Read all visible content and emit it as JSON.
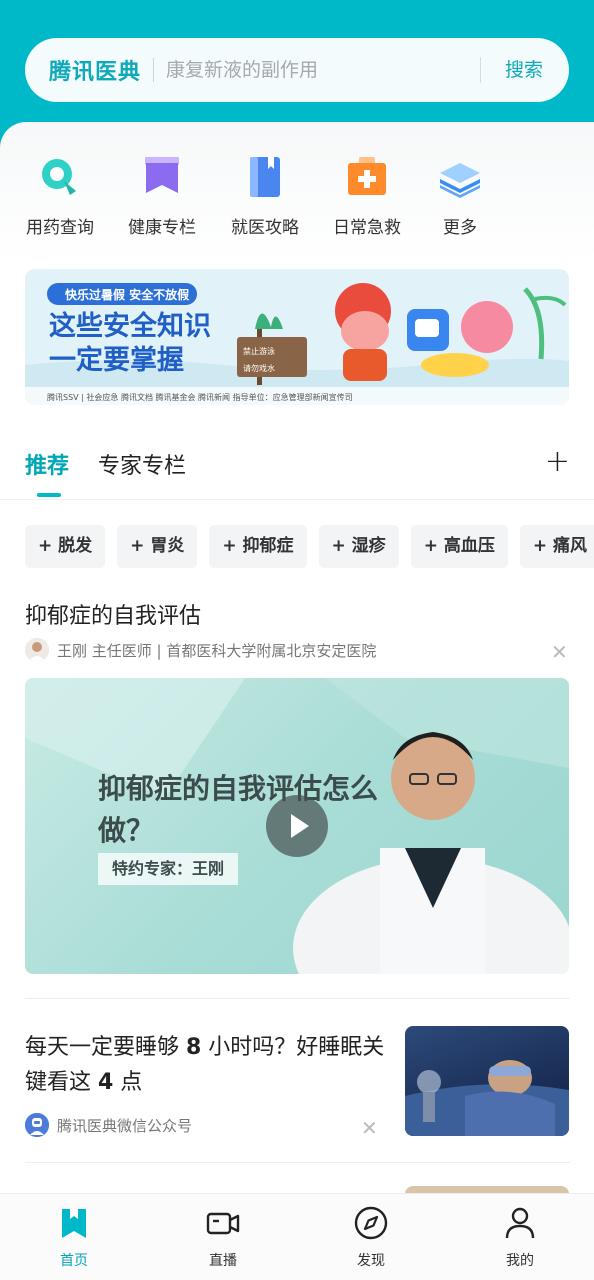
{
  "header": {
    "brand": "腾讯医典",
    "search_placeholder": "康复新液的副作用",
    "search_button": "搜索"
  },
  "quick_entries": [
    {
      "label": "用药查询",
      "icon": "pill-search-icon"
    },
    {
      "label": "健康专栏",
      "icon": "bookmark-icon"
    },
    {
      "label": "就医攻略",
      "icon": "book-icon"
    },
    {
      "label": "日常急救",
      "icon": "first-aid-kit-icon"
    },
    {
      "label": "更多",
      "icon": "layers-icon"
    }
  ],
  "banner": {
    "tagline": "快乐过暑假 安全不放假",
    "headline_line1": "这些安全知识",
    "headline_line2": "一定要掌握",
    "sign1": "禁止游泳",
    "sign2": "请勿戏水",
    "footer": "腾讯SSV | 社会应急   腾讯文档   腾讯基金会   腾讯新闻   指导单位：应急管理部新闻宣传司"
  },
  "tabs": {
    "recommended": "推荐",
    "expert_column": "专家专栏",
    "add": "+"
  },
  "chips": [
    "+ 脱发",
    "+ 胃炎",
    "+ 抑郁症",
    "+ 湿疹",
    "+ 高血压",
    "+ 痛风"
  ],
  "article1": {
    "title": "抑郁症的自我评估",
    "author": "王刚 主任医师 | 首都医科大学附属北京安定医院",
    "video_title": "抑郁症的自我评估怎么做？",
    "video_expert": "特约专家：王刚"
  },
  "article2": {
    "title_part1": "每天一定要睡够 ",
    "title_num1": "8",
    "title_part2": " 小时吗？好睡眠关键看这 ",
    "title_num2": "4",
    "title_part3": " 点",
    "source": "腾讯医典微信公众号"
  },
  "bottom_nav": [
    {
      "label": "首页",
      "icon": "home-bookmark-icon",
      "active": true
    },
    {
      "label": "直播",
      "icon": "video-camera-icon",
      "active": false
    },
    {
      "label": "发现",
      "icon": "compass-icon",
      "active": false
    },
    {
      "label": "我的",
      "icon": "person-icon",
      "active": false
    }
  ],
  "colors": {
    "accent": "#00b9c8",
    "accent_text": "#00a6b6"
  }
}
